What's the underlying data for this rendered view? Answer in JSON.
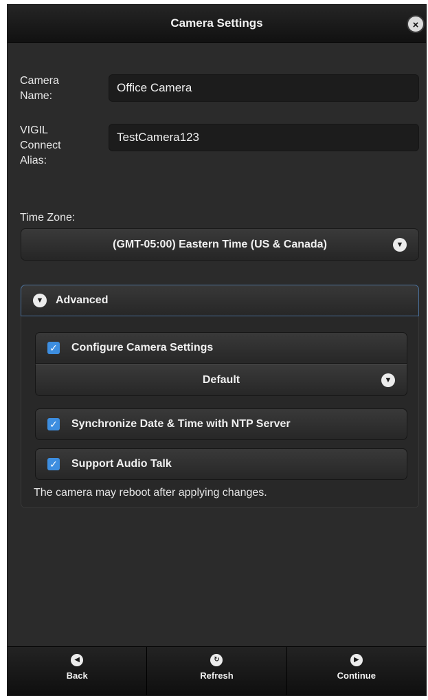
{
  "window": {
    "title": "Camera Settings",
    "close_icon": "×"
  },
  "form": {
    "camera_name_label_line1": "Camera",
    "camera_name_label_line2": "Name:",
    "camera_name_value": "Office Camera",
    "alias_label_line1": "VIGIL",
    "alias_label_line2": "Connect",
    "alias_label_line3": "Alias:",
    "alias_value": "TestCamera123",
    "timezone_label": "Time Zone:",
    "timezone_value": "(GMT-05:00) Eastern Time (US & Canada)"
  },
  "advanced": {
    "label": "Advanced",
    "expanded": true,
    "configure_camera_settings": {
      "label": "Configure Camera Settings",
      "checked": true
    },
    "camera_settings_profile": "Default",
    "sync_ntp": {
      "label": "Synchronize Date & Time with NTP Server",
      "checked": true
    },
    "audio_talk": {
      "label": "Support Audio Talk",
      "checked": true
    },
    "note": "The camera may reboot after applying changes."
  },
  "footer": {
    "back_label": "Back",
    "refresh_label": "Refresh",
    "continue_label": "Continue"
  },
  "icons": {
    "chevron_down": "chevron-down-icon",
    "chevron_left": "chevron-left-icon",
    "chevron_right": "chevron-right-icon",
    "refresh": "refresh-icon",
    "checkmark": "checkmark-icon",
    "close": "close-icon"
  },
  "colors": {
    "accent": "#3d8ee0",
    "focus_border": "#4a6f99",
    "background": "#2b2b2b"
  }
}
